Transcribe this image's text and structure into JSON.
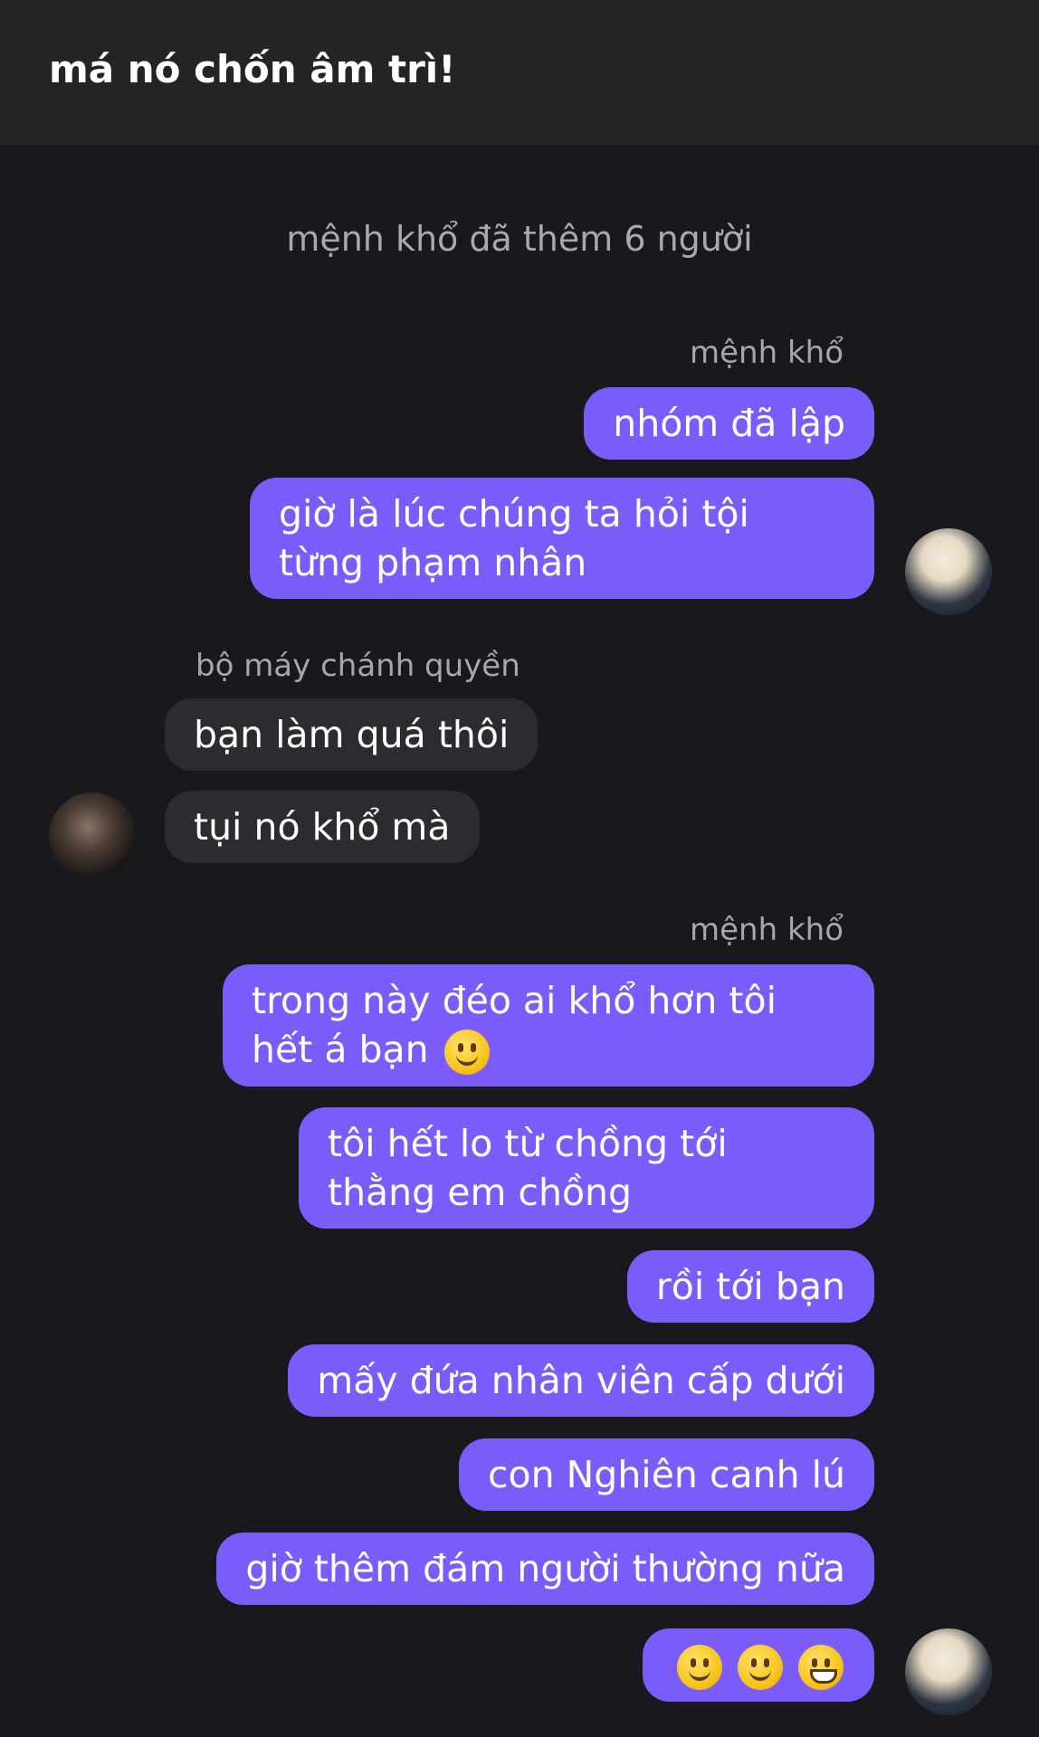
{
  "header": {
    "title": "má nó chốn âm trì!"
  },
  "system_message": "mệnh khổ đã thêm 6 người",
  "messages": {
    "sender_me_1": "mệnh khổ",
    "m1": "nhóm đã lập",
    "m2": "giờ là lúc chúng ta hỏi tội từng phạm nhân",
    "sender_them": "bộ máy chánh quyền",
    "m3": "bạn làm quá thôi",
    "m4": "tụi nó khổ mà",
    "sender_me_2": "mệnh khổ",
    "m5": "trong này đéo ai khổ hơn tôi hết á bạn",
    "m6": "tôi hết lo từ chồng tới thằng em chồng",
    "m7": "rồi tới bạn",
    "m8": "mấy đứa nhân viên cấp dưới",
    "m9": "con Nghiên canh lú",
    "m10": "giờ thêm đám người thường nữa"
  },
  "icons": {
    "m5_emoji": "slightly-smiling-face-emoji",
    "m11_emojis": [
      "slightly-smiling-face-emoji",
      "slightly-smiling-face-emoji",
      "grinning-face-emoji"
    ]
  },
  "colors": {
    "background": "#19181d",
    "header": "#242427",
    "outgoing_bubble": "#7b5cfa",
    "incoming_bubble": "#2c2c30"
  }
}
